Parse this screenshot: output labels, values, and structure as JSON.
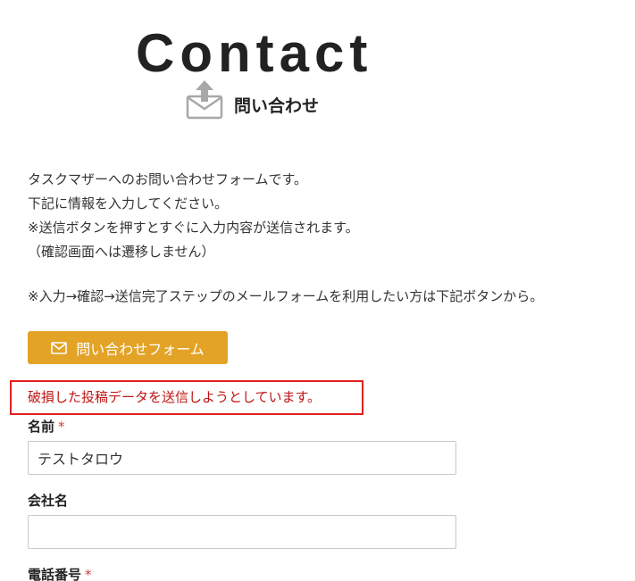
{
  "header": {
    "title": "Contact",
    "subtitle": "問い合わせ",
    "icon": "envelope-upload-icon"
  },
  "intro": {
    "lines": [
      "タスクマザーへのお問い合わせフォームです。",
      "下記に情報を入力してください。",
      "※送信ボタンを押すとすぐに入力内容が送信されます。",
      "（確認画面へは遷移しません）"
    ],
    "note": "※入力→確認→送信完了ステップのメールフォームを利用したい方は下記ボタンから。"
  },
  "form_link": {
    "label": "問い合わせフォーム",
    "icon": "mail-icon",
    "color": "#e3a327"
  },
  "error": {
    "message": "破損した投稿データを送信しようとしています。",
    "border_color": "#e02020",
    "text_color": "#c01414"
  },
  "fields": {
    "name": {
      "label": "名前",
      "required_mark": "*",
      "value": "テストタロウ"
    },
    "company": {
      "label": "会社名",
      "value": ""
    },
    "phone": {
      "label": "電話番号",
      "required_mark": "*"
    }
  }
}
